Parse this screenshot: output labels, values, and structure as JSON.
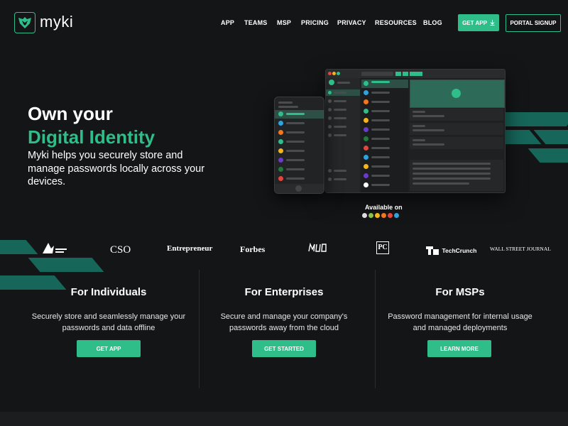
{
  "header": {
    "logo_text": "myki",
    "logo_icon": "myki-shield-icon",
    "nav": [
      "APP",
      "TEAMS",
      "MSP",
      "PRICING",
      "PRIVACY",
      "RESOURCES",
      "BLOG"
    ],
    "get_app_label": "GET APP",
    "get_app_icon": "download-icon",
    "portal_signup_label": "PORTAL SIGNUP"
  },
  "hero": {
    "line1": "Own your",
    "line2": "Digital Identity",
    "subtitle": "Myki helps you securely store and manage passwords locally across your devices.",
    "available_on": "Available on",
    "platform_icons": [
      "apple-icon",
      "android-icon",
      "chrome-icon",
      "firefox-icon",
      "opera-icon",
      "edge-icon"
    ]
  },
  "press": [
    "CSO",
    "Entrepreneur",
    "Forbes",
    "PC",
    "TechCrunch",
    "WALL STREET JOURNAL"
  ],
  "columns": [
    {
      "title": "For Individuals",
      "text": "Securely store and seamlessly manage your passwords and data offline",
      "button": "GET APP"
    },
    {
      "title": "For Enterprises",
      "text": "Secure and manage your company's passwords away from the cloud",
      "button": "GET STARTED"
    },
    {
      "title": "For MSPs",
      "text": "Password management for internal usage and managed deployments",
      "button": "LEARN MORE"
    }
  ],
  "colors": {
    "accent": "#2fbd8a",
    "stripe": "#16665a",
    "background": "#141516"
  }
}
